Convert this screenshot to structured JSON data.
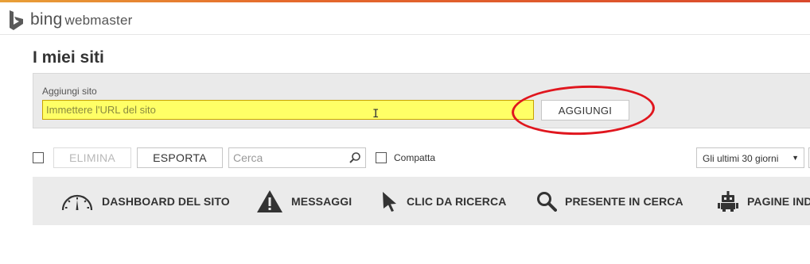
{
  "brand": {
    "name_part1": "bing",
    "name_part2": "webmaster"
  },
  "page": {
    "title": "I miei siti"
  },
  "add_site": {
    "label": "Aggiungi sito",
    "placeholder": "Immettere l'URL del sito",
    "value": "",
    "button_label": "AGGIUNGI",
    "highlight_color": "#e0161e",
    "input_highlight_color": "#ffff66"
  },
  "toolbar": {
    "delete_label": "ELIMINA",
    "export_label": "ESPORTA",
    "search_placeholder": "Cerca",
    "compact_label": "Compatta",
    "period_selected": "Gli ultimi 30 giorni"
  },
  "nav": {
    "items": [
      {
        "label": "DASHBOARD DEL SITO",
        "icon": "gauge-icon"
      },
      {
        "label": "MESSAGGI",
        "icon": "warning-icon"
      },
      {
        "label": "CLIC DA RICERCA",
        "icon": "cursor-icon"
      },
      {
        "label": "PRESENTE IN CERCA",
        "icon": "magnifier-icon"
      },
      {
        "label": "PAGINE IND",
        "icon": "robot-icon"
      }
    ]
  },
  "colors": {
    "accent_stripe": "#e56a2c",
    "nav_background": "#ebebeb",
    "panel_background": "#eaeaea"
  }
}
